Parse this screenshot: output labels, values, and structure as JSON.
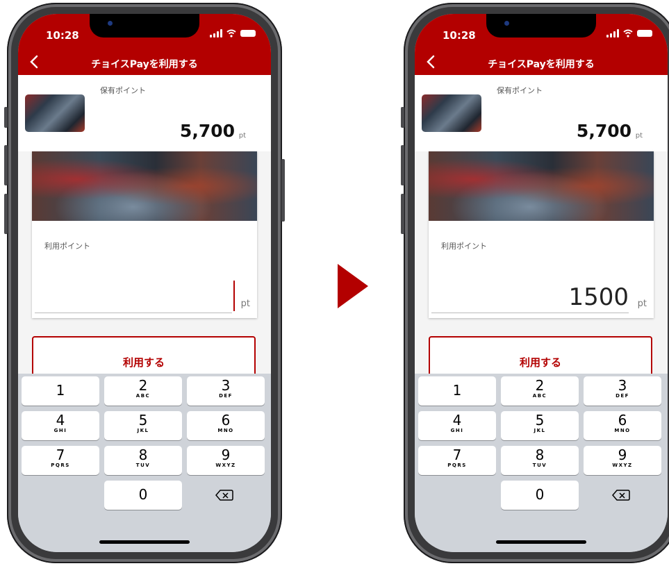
{
  "screens": [
    {
      "status": {
        "time": "10:28"
      },
      "nav": {
        "title": "チョイスPayを利用する"
      },
      "held": {
        "label": "保有ポイント",
        "value": "5,700",
        "unit": "pt"
      },
      "use": {
        "label": "利用ポイント",
        "value": "",
        "unit": "pt"
      },
      "button": {
        "label": "利用する"
      },
      "keypad": {
        "keys": [
          {
            "num": "1",
            "letters": ""
          },
          {
            "num": "2",
            "letters": "ABC"
          },
          {
            "num": "3",
            "letters": "DEF"
          },
          {
            "num": "4",
            "letters": "GHI"
          },
          {
            "num": "5",
            "letters": "JKL"
          },
          {
            "num": "6",
            "letters": "MNO"
          },
          {
            "num": "7",
            "letters": "PQRS"
          },
          {
            "num": "8",
            "letters": "TUV"
          },
          {
            "num": "9",
            "letters": "WXYZ"
          },
          {
            "num": "0",
            "letters": ""
          }
        ],
        "delete": "delete-icon"
      }
    },
    {
      "status": {
        "time": "10:28"
      },
      "nav": {
        "title": "チョイスPayを利用する"
      },
      "held": {
        "label": "保有ポイント",
        "value": "5,700",
        "unit": "pt"
      },
      "use": {
        "label": "利用ポイント",
        "value": "1500",
        "unit": "pt"
      },
      "button": {
        "label": "利用する"
      },
      "keypad": {
        "keys": [
          {
            "num": "1",
            "letters": ""
          },
          {
            "num": "2",
            "letters": "ABC"
          },
          {
            "num": "3",
            "letters": "DEF"
          },
          {
            "num": "4",
            "letters": "GHI"
          },
          {
            "num": "5",
            "letters": "JKL"
          },
          {
            "num": "6",
            "letters": "MNO"
          },
          {
            "num": "7",
            "letters": "PQRS"
          },
          {
            "num": "8",
            "letters": "TUV"
          },
          {
            "num": "9",
            "letters": "WXYZ"
          },
          {
            "num": "0",
            "letters": ""
          }
        ],
        "delete": "delete-icon"
      }
    }
  ],
  "transition_icon": "right-arrow-icon",
  "colors": {
    "brand": "#b30000",
    "keypad_bg": "#cfd3d9"
  }
}
